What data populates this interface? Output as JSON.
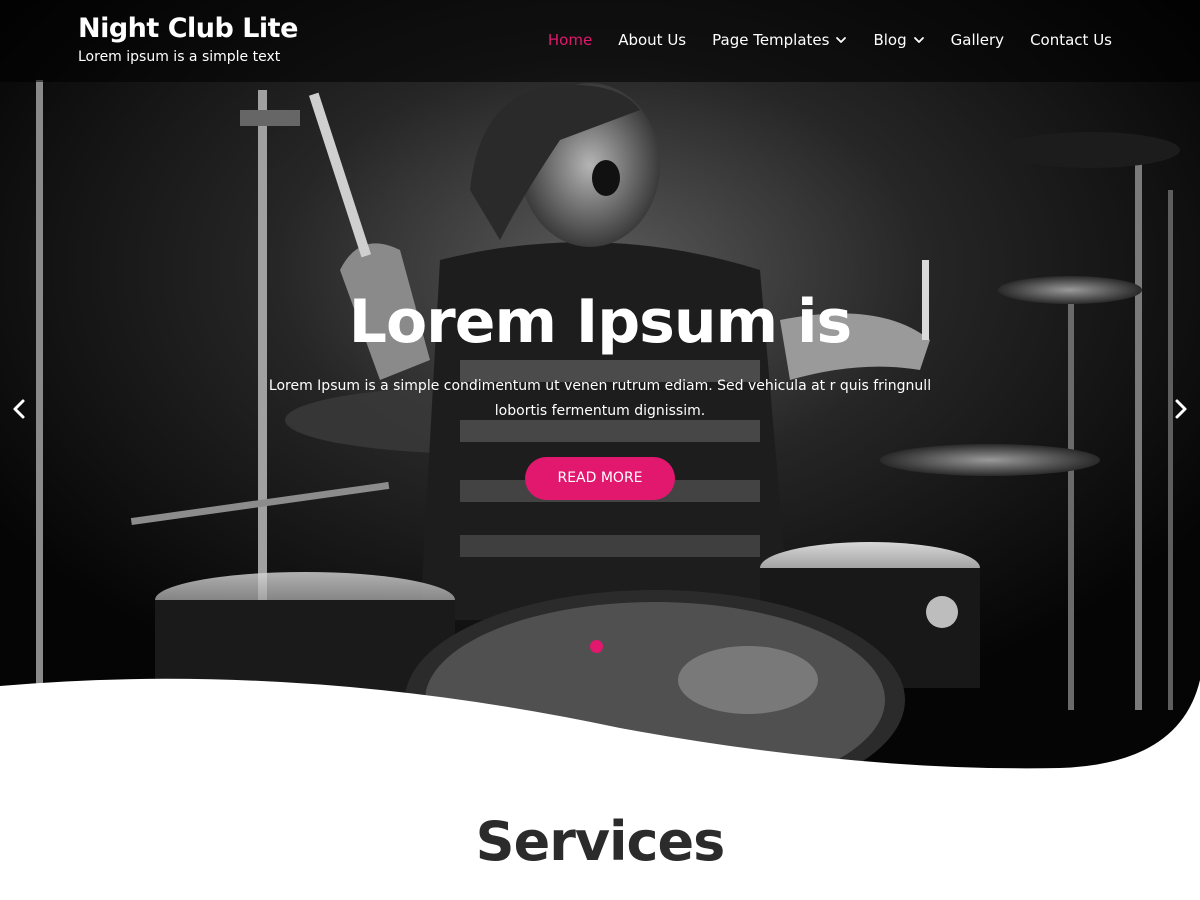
{
  "site": {
    "title": "Night Club Lite",
    "tagline": "Lorem ipsum is a simple text"
  },
  "nav": {
    "items": [
      {
        "label": "Home",
        "active": true,
        "has_dropdown": false
      },
      {
        "label": "About Us",
        "active": false,
        "has_dropdown": false
      },
      {
        "label": "Page Templates",
        "active": false,
        "has_dropdown": true
      },
      {
        "label": "Blog",
        "active": false,
        "has_dropdown": true
      },
      {
        "label": "Gallery",
        "active": false,
        "has_dropdown": false
      },
      {
        "label": "Contact Us",
        "active": false,
        "has_dropdown": false
      }
    ]
  },
  "hero": {
    "title": "Lorem Ipsum is",
    "description": "Lorem Ipsum is a simple condimentum ut venen rutrum ediam. Sed vehicula at r quis fringnull lobortis fermentum dignissim.",
    "button_label": "READ MORE",
    "prev_icon": "chevron-left-icon",
    "next_icon": "chevron-right-icon",
    "slide_count": 1,
    "active_slide": 1
  },
  "services": {
    "heading": "Services"
  },
  "colors": {
    "accent": "#e2176e",
    "header_bg": "#000000",
    "text_light": "#ffffff",
    "heading_dark": "#2b2b2b",
    "page_bg": "#ffffff"
  }
}
